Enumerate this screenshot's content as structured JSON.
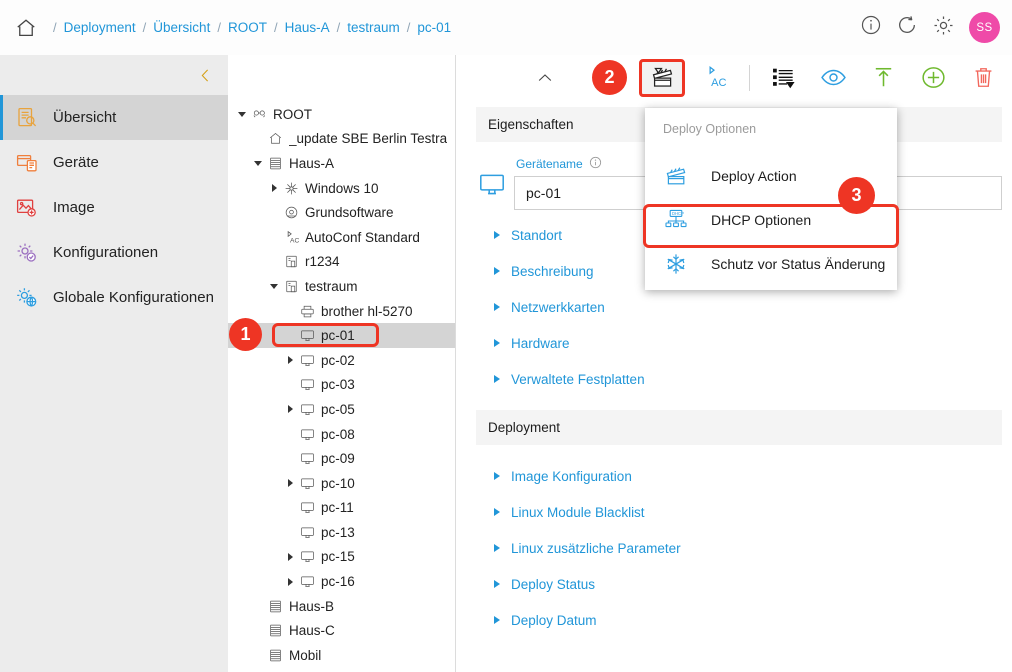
{
  "breadcrumb": {
    "home_icon": "home-icon",
    "separator": "/",
    "items": [
      {
        "label": "Deployment"
      },
      {
        "label": "Übersicht"
      },
      {
        "label": "ROOT"
      },
      {
        "label": "Haus-A"
      },
      {
        "label": "testraum"
      },
      {
        "label": "pc-01"
      }
    ]
  },
  "topbar_actions": [
    {
      "name": "info-icon",
      "label": "Info"
    },
    {
      "name": "refresh-icon",
      "label": "Aktualisieren"
    },
    {
      "name": "gear-icon",
      "label": "Einstellungen"
    }
  ],
  "avatar": {
    "initials": "SS",
    "color": "#ef4aa8"
  },
  "sidebar": {
    "collapse_icon": "chevron-left-icon",
    "items": [
      {
        "label": "Übersicht",
        "icon": "overview-document-search-icon",
        "active": true
      },
      {
        "label": "Geräte",
        "icon": "devices-icon",
        "active": false
      },
      {
        "label": "Image",
        "icon": "image-icon",
        "active": false
      },
      {
        "label": "Konfigurationen",
        "icon": "configurations-gear-icon",
        "active": false
      },
      {
        "label": "Globale Konfigurationen",
        "icon": "global-configurations-icon",
        "active": false
      }
    ]
  },
  "tree": {
    "nodes": [
      {
        "label": "ROOT",
        "indent": 0,
        "caret": "open",
        "icon": "root-icon",
        "selected": false
      },
      {
        "label": "_update SBE Berlin Testra",
        "indent": 1,
        "caret": "none",
        "icon": "home-small-icon",
        "selected": false
      },
      {
        "label": "Haus-A",
        "indent": 1,
        "caret": "open",
        "icon": "building-icon",
        "selected": false
      },
      {
        "label": "Windows 10",
        "indent": 2,
        "caret": "closed",
        "icon": "windows-icon",
        "selected": false
      },
      {
        "label": "Grundsoftware",
        "indent": 2,
        "caret": "none",
        "icon": "software-icon",
        "selected": false
      },
      {
        "label": "AutoConf Standard",
        "indent": 2,
        "caret": "none",
        "icon": "autoconf-icon",
        "selected": false
      },
      {
        "label": "r1234",
        "indent": 2,
        "caret": "none",
        "icon": "room-icon",
        "selected": false
      },
      {
        "label": "testraum",
        "indent": 2,
        "caret": "open",
        "icon": "room-icon",
        "selected": false
      },
      {
        "label": "brother hl-5270",
        "indent": 3,
        "caret": "none",
        "icon": "printer-icon",
        "selected": false
      },
      {
        "label": "pc-01",
        "indent": 3,
        "caret": "none",
        "icon": "monitor-icon",
        "selected": true
      },
      {
        "label": "pc-02",
        "indent": 3,
        "caret": "closed",
        "icon": "monitor-icon",
        "selected": false
      },
      {
        "label": "pc-03",
        "indent": 3,
        "caret": "none",
        "icon": "monitor-icon",
        "selected": false
      },
      {
        "label": "pc-05",
        "indent": 3,
        "caret": "closed",
        "icon": "monitor-icon",
        "selected": false
      },
      {
        "label": "pc-08",
        "indent": 3,
        "caret": "none",
        "icon": "monitor-icon",
        "selected": false
      },
      {
        "label": "pc-09",
        "indent": 3,
        "caret": "none",
        "icon": "monitor-icon",
        "selected": false
      },
      {
        "label": "pc-10",
        "indent": 3,
        "caret": "closed",
        "icon": "monitor-icon",
        "selected": false
      },
      {
        "label": "pc-11",
        "indent": 3,
        "caret": "none",
        "icon": "monitor-icon",
        "selected": false
      },
      {
        "label": "pc-13",
        "indent": 3,
        "caret": "none",
        "icon": "monitor-icon",
        "selected": false
      },
      {
        "label": "pc-15",
        "indent": 3,
        "caret": "closed",
        "icon": "monitor-icon",
        "selected": false
      },
      {
        "label": "pc-16",
        "indent": 3,
        "caret": "closed",
        "icon": "monitor-icon",
        "selected": false
      },
      {
        "label": "Haus-B",
        "indent": 1,
        "caret": "none",
        "icon": "building-icon",
        "selected": false
      },
      {
        "label": "Haus-C",
        "indent": 1,
        "caret": "none",
        "icon": "building-icon",
        "selected": false
      },
      {
        "label": "Mobil",
        "indent": 1,
        "caret": "none",
        "icon": "building-icon",
        "selected": false
      }
    ]
  },
  "toolbar": {
    "nav": [
      {
        "name": "collapse-up-icon",
        "label": "Nach oben"
      },
      {
        "name": "back-chevron-icon",
        "label": "Zurück"
      }
    ],
    "actions": [
      {
        "name": "deploy-clapperboard-icon",
        "label": "Deploy Optionen",
        "highlighted": true
      },
      {
        "name": "autoconf-ac-icon",
        "label": "AutoConf"
      },
      {
        "name": "list-filter-icon",
        "label": "Listenansicht"
      },
      {
        "name": "eye-icon",
        "label": "Ansicht"
      },
      {
        "name": "upload-arrow-icon",
        "label": "Hochladen"
      },
      {
        "name": "add-plus-icon",
        "label": "Hinzufügen"
      },
      {
        "name": "trash-icon",
        "label": "Löschen"
      }
    ]
  },
  "main": {
    "sections": [
      {
        "title": "Eigenschaften"
      },
      {
        "title": "Deployment"
      }
    ],
    "properties_header": "Eigenschaften",
    "deployment_header": "Deployment",
    "device_field": {
      "label": "Gerätename",
      "info_icon": "info-circle-icon",
      "value": "pc-01",
      "device_icon": "monitor-icon"
    },
    "properties_accordions": [
      {
        "label": "Standort"
      },
      {
        "label": "Beschreibung"
      },
      {
        "label": "Netzwerkkarten"
      },
      {
        "label": "Hardware"
      },
      {
        "label": "Verwaltete Festplatten"
      }
    ],
    "deployment_accordions": [
      {
        "label": "Image Konfiguration"
      },
      {
        "label": "Linux Module Blacklist"
      },
      {
        "label": "Linux zusätzliche Parameter"
      },
      {
        "label": "Deploy Status"
      },
      {
        "label": "Deploy Datum"
      }
    ]
  },
  "menu": {
    "title": "Deploy Optionen",
    "items": [
      {
        "label": "Deploy Action",
        "icon": "clapperboard-icon",
        "highlighted": false
      },
      {
        "label": "DHCP Optionen",
        "icon": "dhcp-network-icon",
        "highlighted": true
      },
      {
        "label": "Schutz vor Status Änderung",
        "icon": "snowflake-icon",
        "highlighted": false
      }
    ]
  },
  "annotations": [
    {
      "number": "1",
      "target": "tree-node-pc-01"
    },
    {
      "number": "2",
      "target": "toolbar-deploy-button"
    },
    {
      "number": "3",
      "target": "menu-item-dhcp-optionen"
    }
  ],
  "colors": {
    "accent_blue": "#2196d8",
    "annotation_red": "#ee3524",
    "avatar_pink": "#ef4aa8",
    "sidebar_bg": "#ececec",
    "selected_bg": "#d4d4d4"
  }
}
